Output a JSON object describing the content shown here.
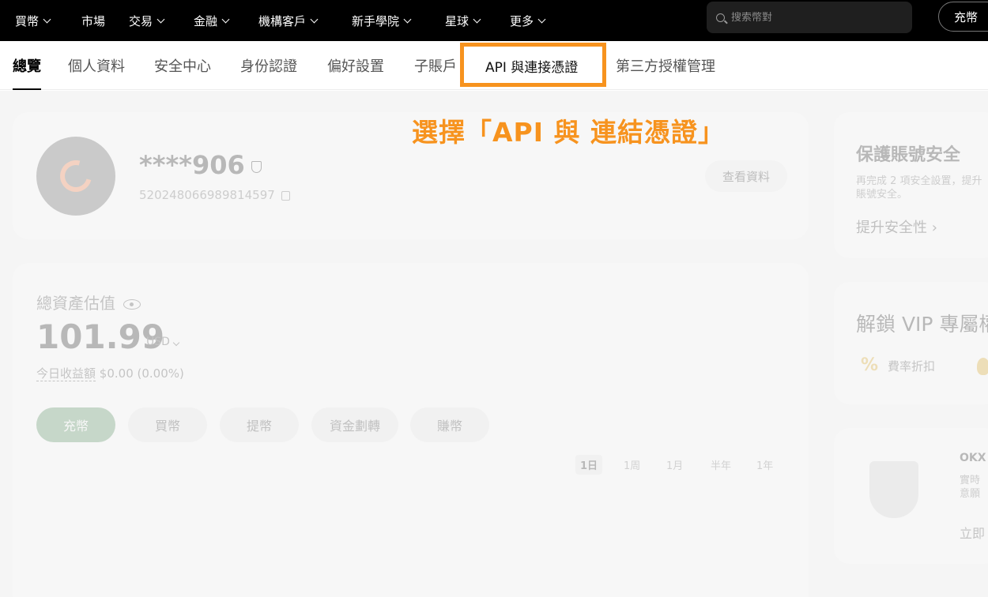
{
  "topnav": {
    "items": [
      {
        "label": "買幣"
      },
      {
        "label": "市場"
      },
      {
        "label": "交易"
      },
      {
        "label": "金融"
      },
      {
        "label": "機構客戶"
      },
      {
        "label": "新手學院"
      },
      {
        "label": "星球"
      },
      {
        "label": "更多"
      }
    ],
    "search_placeholder": "搜索幣對",
    "deposit_label": "充幣"
  },
  "tabs": {
    "items": [
      {
        "label": "總覽",
        "active": true
      },
      {
        "label": "個人資料"
      },
      {
        "label": "安全中心"
      },
      {
        "label": "身份認證"
      },
      {
        "label": "偏好設置"
      },
      {
        "label": "子賬戶"
      },
      {
        "label": "API 與連接憑證",
        "highlighted": true
      },
      {
        "label": "第三方授權管理"
      }
    ]
  },
  "annotation": {
    "text": "選擇「API 與 連結憑證」",
    "color": "#f7931e"
  },
  "profile": {
    "name": "****906",
    "uid": "520248066989814597",
    "view_button": "查看資料"
  },
  "assets": {
    "label": "總資產估值",
    "value": "101.99",
    "currency": "USD",
    "pnl_label": "今日收益額",
    "pnl_value": "$0.00 (0.00%)",
    "actions": [
      {
        "label": "充幣"
      },
      {
        "label": "買幣"
      },
      {
        "label": "提幣"
      },
      {
        "label": "資金劃轉"
      },
      {
        "label": "賺幣"
      }
    ],
    "periods": [
      {
        "label": "1日",
        "active": true
      },
      {
        "label": "1周"
      },
      {
        "label": "1月"
      },
      {
        "label": "半年"
      },
      {
        "label": "1年"
      }
    ]
  },
  "sidebar": {
    "security": {
      "title": "保護賬號安全",
      "desc": "再完成 2 項安全設置，提升賬號安全。",
      "link": "提升安全性"
    },
    "vip": {
      "title": "解鎖 VIP 專屬權益",
      "item1": "費率折扣"
    },
    "promo": {
      "title": "OKX",
      "line1": "實時",
      "line2": "意願",
      "link": "立即"
    }
  }
}
